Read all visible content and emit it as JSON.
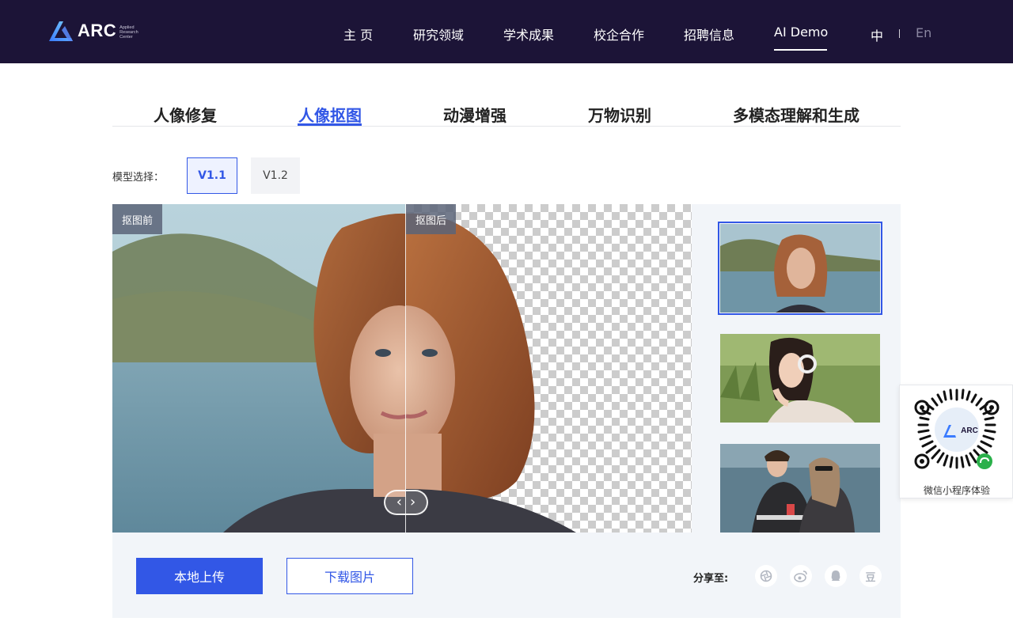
{
  "header": {
    "logo_text": "ARC",
    "logo_sub": [
      "Applied",
      "Research",
      "Center"
    ],
    "nav": [
      {
        "label": "主 页"
      },
      {
        "label": "研究领域"
      },
      {
        "label": "学术成果"
      },
      {
        "label": "校企合作"
      },
      {
        "label": "招聘信息"
      },
      {
        "label": "AI Demo",
        "active": true
      }
    ],
    "lang": {
      "zh": "中",
      "en": "En"
    }
  },
  "tabs": [
    {
      "label": "人像修复"
    },
    {
      "label": "人像抠图",
      "active": true
    },
    {
      "label": "动漫增强"
    },
    {
      "label": "万物识别"
    },
    {
      "label": "多模态理解和生成"
    }
  ],
  "model": {
    "label": "模型选择：",
    "options": [
      {
        "label": "V1.1",
        "selected": true
      },
      {
        "label": "V1.2"
      }
    ]
  },
  "compare": {
    "before_label": "抠图前",
    "after_label": "抠图后"
  },
  "actions": {
    "upload": "本地上传",
    "download": "下载图片"
  },
  "share": {
    "label": "分享至:",
    "icons": [
      "wechat-moments-icon",
      "weibo-icon",
      "qq-icon",
      "douban-icon"
    ],
    "douban_glyph": "豆"
  },
  "qr": {
    "caption": "微信小程序体验",
    "center_text": "ARC"
  },
  "colors": {
    "header_bg": "#1c1437",
    "accent": "#3257e6",
    "panel_bg": "#f2f5f9"
  }
}
